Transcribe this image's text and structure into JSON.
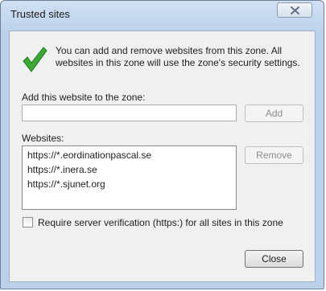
{
  "window": {
    "title": "Trusted sites"
  },
  "info": {
    "icon": "green-checkmark-icon",
    "text": "You can add and remove websites from this zone. All websites in this zone will use the zone's security settings."
  },
  "add_section": {
    "label": "Add this website to the zone:",
    "input_value": "",
    "add_button_label": "Add"
  },
  "websites_section": {
    "label": "Websites:",
    "items": [
      "https://*.eordinationpascal.se",
      "https://*.inera.se",
      "https://*.sjunet.org"
    ],
    "remove_button_label": "Remove"
  },
  "verification": {
    "label": "Require server verification (https:) for all sites in this zone",
    "checked": false
  },
  "footer": {
    "close_button_label": "Close"
  },
  "colors": {
    "accent_check": "#2e9e2e",
    "titlebar": "#c7dbf1"
  }
}
